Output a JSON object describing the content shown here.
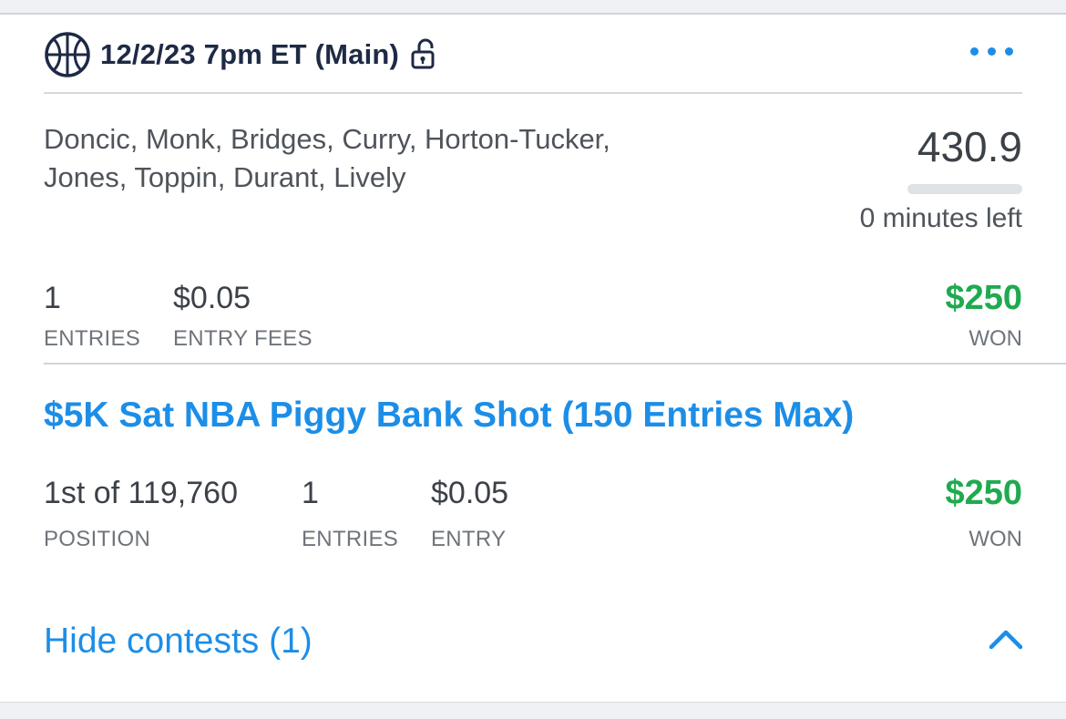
{
  "header": {
    "title": "12/2/23 7pm ET (Main)",
    "sport_icon": "basketball-icon",
    "lock_icon": "unlocked-padlock-icon",
    "menu_icon": "more-dots-icon"
  },
  "lineup": {
    "players_line1": "Doncic, Monk, Bridges, Curry, Horton-Tucker,",
    "players_line2": "Jones, Toppin, Durant, Lively",
    "score": "430.9",
    "progress_fraction": 0.0,
    "time_left": "0 minutes left"
  },
  "summary": {
    "entries_value": "1",
    "entries_label": "ENTRIES",
    "fees_value": "$0.05",
    "fees_label": "ENTRY FEES",
    "won_value": "$250",
    "won_label": "WON"
  },
  "contest": {
    "title": "$5K Sat NBA Piggy Bank Shot (150 Entries Max)",
    "position_value": "1st of 119,760",
    "position_label": "POSITION",
    "entries_value": "1",
    "entries_label": "ENTRIES",
    "entry_value": "$0.05",
    "entry_label": "ENTRY",
    "won_value": "$250",
    "won_label": "WON"
  },
  "footer": {
    "hide_label": "Hide contests (1)",
    "toggle_icon": "chevron-up-icon"
  },
  "colors": {
    "accent_blue": "#1c8ee8",
    "won_green": "#1faa4f",
    "title_navy": "#1e2a45"
  }
}
